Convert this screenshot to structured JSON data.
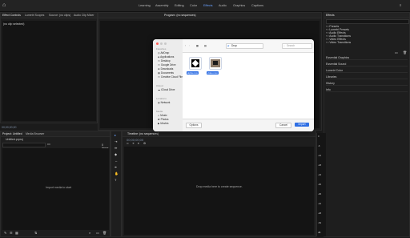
{
  "app": {
    "top_tabs": [
      "Learning",
      "Assembly",
      "Editing",
      "Color",
      "Effects",
      "Audio",
      "Graphics",
      "Captions"
    ],
    "active_top_tab_index": 4
  },
  "effect_controls": {
    "tabs": [
      "Effect Controls",
      "Lumetri Scopes",
      "Source: (no clips)",
      "Audio Clip Mixer"
    ],
    "content": "(no clip selected)",
    "timestamp": "00;00;00;00"
  },
  "program_monitor": {
    "tab_label": "Program: (no sequences)"
  },
  "effects_panel": {
    "title": "Effects",
    "items": [
      "Presets",
      "Lumetri Presets",
      "Audio Effects",
      "Audio Transitions",
      "Video Effects",
      "Video Transitions"
    ],
    "sections": [
      "Essential Graphics",
      "Essential Sound",
      "Lumetri Color",
      "Libraries",
      "History",
      "Info"
    ]
  },
  "project_panel": {
    "tabs": [
      "Project: Untitled",
      "Media Browser"
    ],
    "file_name": "Untitled.prproj",
    "count_label": "0 Items",
    "empty_text": "Import media to start"
  },
  "timeline": {
    "tab_label": "Timeline: (no sequences)",
    "timecode": "00;00;00;00",
    "empty_text": "Drop media here to create sequence."
  },
  "file_dialog": {
    "location": "Drop",
    "search_placeholder": "Search",
    "sidebar_sections": [
      {
        "title": "Favorites",
        "items": [
          "AirDrop",
          "Applications",
          "Desktop",
          "Google Drive",
          "Downloads",
          "Documents",
          "Creative Cloud Files"
        ]
      },
      {
        "title": "iCloud",
        "items": [
          "iCloud Drive"
        ]
      },
      {
        "title": "Locations",
        "items": [
          "Network"
        ]
      },
      {
        "title": "Media",
        "items": [
          "Music",
          "Photos",
          "Movies"
        ]
      }
    ],
    "files": [
      {
        "name": "alpha.mov"
      },
      {
        "name": "video.mov"
      }
    ],
    "options_label": "Options",
    "cancel_label": "Cancel",
    "import_label": "Import"
  },
  "audio_meter": {
    "scale": [
      "0",
      "-6",
      "-12",
      "-18",
      "-24",
      "-30",
      "-36",
      "-42",
      "-48",
      "-54",
      "dB"
    ]
  }
}
